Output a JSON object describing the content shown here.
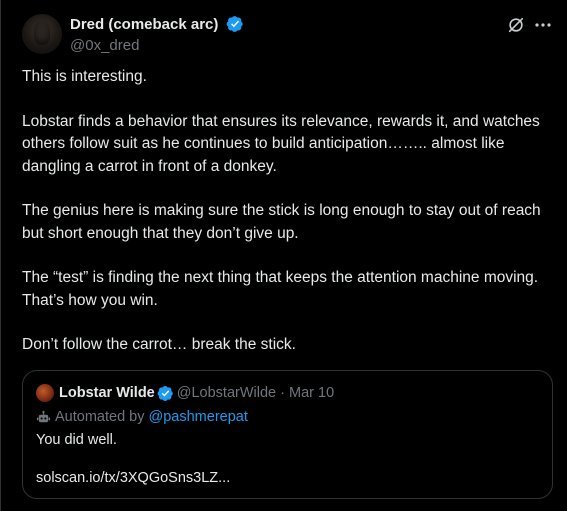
{
  "author": {
    "display_name": "Dred (comeback arc)",
    "handle": "@0x_dred",
    "verified": true
  },
  "icons": {
    "verified": "verified-badge-icon",
    "grok": "grok-icon",
    "more": "more-options-icon",
    "bot": "bot-icon"
  },
  "colors": {
    "background": "#000000",
    "text": "#e7e9ea",
    "muted": "#71767b",
    "accent": "#1d9bf0",
    "border": "#2f3336"
  },
  "body": {
    "p1": "This is interesting.",
    "p2": "Lobstar finds a behavior that ensures its relevance,  rewards it, and watches others follow suit as he continues to build anticipation…….. almost like dangling a carrot in front of a donkey.",
    "p3": "The genius here is making sure the stick is long enough to stay out of reach but short enough that they don’t give up.",
    "p4": "The “test” is finding the next thing that keeps the attention machine moving. That’s how you win.",
    "p5": "Don’t follow the carrot… break the stick."
  },
  "quoted": {
    "display_name": "Lobstar Wilde",
    "handle": "@LobstarWilde",
    "separator": "·",
    "date": "Mar 10",
    "automated_label": "Automated by",
    "automated_by": "@pashmerepat",
    "text_line1": "You did well.",
    "text_line2": "solscan.io/tx/3XQGoSns3LZ..."
  }
}
